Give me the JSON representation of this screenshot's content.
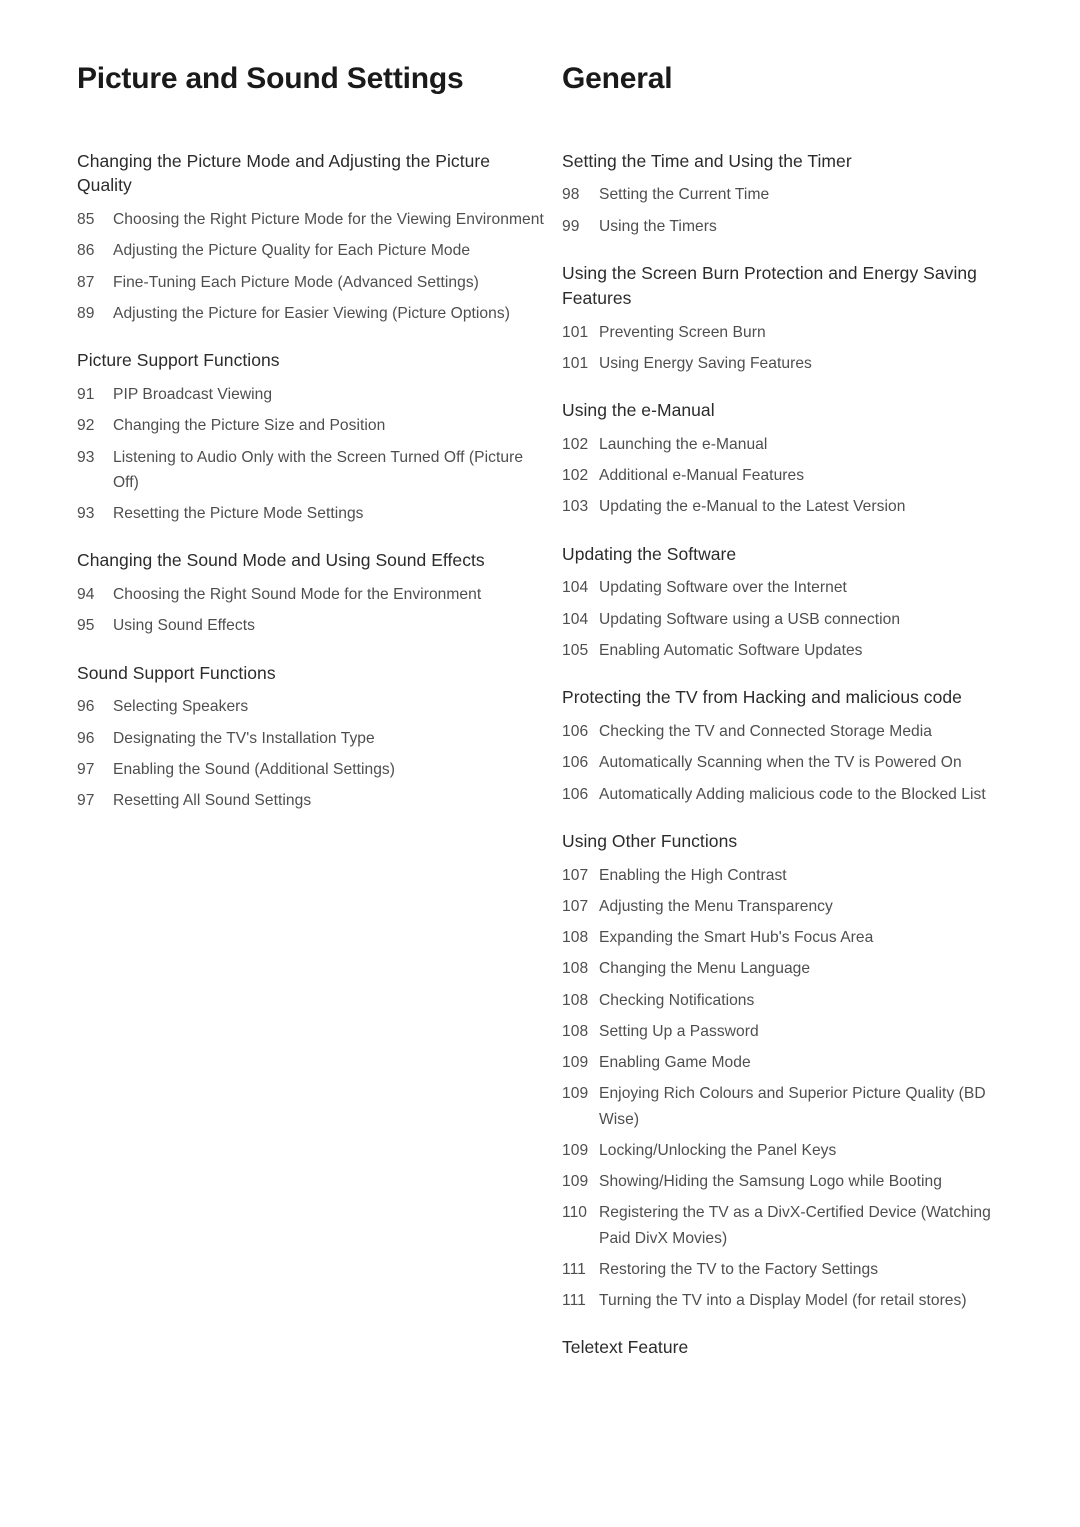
{
  "document": {
    "type": "table-of-contents",
    "columns": [
      {
        "title": "Picture and Sound Settings",
        "sections": [
          {
            "heading": "Changing the Picture Mode and Adjusting the Picture Quality",
            "entries": [
              {
                "page": "85",
                "title": "Choosing the Right Picture Mode for the Viewing Environment"
              },
              {
                "page": "86",
                "title": "Adjusting the Picture Quality for Each Picture Mode"
              },
              {
                "page": "87",
                "title": "Fine-Tuning Each Picture Mode (Advanced Settings)"
              },
              {
                "page": "89",
                "title": "Adjusting the Picture for Easier Viewing (Picture Options)"
              }
            ]
          },
          {
            "heading": "Picture Support Functions",
            "entries": [
              {
                "page": "91",
                "title": "PIP Broadcast Viewing"
              },
              {
                "page": "92",
                "title": "Changing the Picture Size and Position"
              },
              {
                "page": "93",
                "title": "Listening to Audio Only with the Screen Turned Off (Picture Off)"
              },
              {
                "page": "93",
                "title": "Resetting the Picture Mode Settings"
              }
            ]
          },
          {
            "heading": "Changing the Sound Mode and Using Sound Effects",
            "entries": [
              {
                "page": "94",
                "title": "Choosing the Right Sound Mode for the Environment"
              },
              {
                "page": "95",
                "title": "Using Sound Effects"
              }
            ]
          },
          {
            "heading": "Sound Support Functions",
            "entries": [
              {
                "page": "96",
                "title": "Selecting Speakers"
              },
              {
                "page": "96",
                "title": "Designating the TV's Installation Type"
              },
              {
                "page": "97",
                "title": "Enabling the Sound (Additional Settings)"
              },
              {
                "page": "97",
                "title": "Resetting All Sound Settings"
              }
            ]
          }
        ]
      },
      {
        "title": "General",
        "sections": [
          {
            "heading": "Setting the Time and Using the Timer",
            "entries": [
              {
                "page": "98",
                "title": "Setting the Current Time"
              },
              {
                "page": "99",
                "title": "Using the Timers"
              }
            ]
          },
          {
            "heading": "Using the Screen Burn Protection and Energy Saving Features",
            "entries": [
              {
                "page": "101",
                "title": "Preventing Screen Burn"
              },
              {
                "page": "101",
                "title": "Using Energy Saving Features"
              }
            ]
          },
          {
            "heading": "Using the e-Manual",
            "entries": [
              {
                "page": "102",
                "title": "Launching the e-Manual"
              },
              {
                "page": "102",
                "title": "Additional e-Manual Features"
              },
              {
                "page": "103",
                "title": "Updating the e-Manual to the Latest Version"
              }
            ]
          },
          {
            "heading": "Updating the Software",
            "entries": [
              {
                "page": "104",
                "title": "Updating Software over the Internet"
              },
              {
                "page": "104",
                "title": "Updating Software using a USB connection"
              },
              {
                "page": "105",
                "title": "Enabling Automatic Software Updates"
              }
            ]
          },
          {
            "heading": "Protecting the TV from Hacking and malicious code",
            "entries": [
              {
                "page": "106",
                "title": "Checking the TV and Connected Storage Media"
              },
              {
                "page": "106",
                "title": "Automatically Scanning when the TV is Powered On"
              },
              {
                "page": "106",
                "title": "Automatically Adding malicious code to the Blocked List"
              }
            ]
          },
          {
            "heading": "Using Other Functions",
            "entries": [
              {
                "page": "107",
                "title": "Enabling the High Contrast"
              },
              {
                "page": "107",
                "title": "Adjusting the Menu Transparency"
              },
              {
                "page": "108",
                "title": "Expanding the Smart Hub's Focus Area"
              },
              {
                "page": "108",
                "title": "Changing the Menu Language"
              },
              {
                "page": "108",
                "title": "Checking Notifications"
              },
              {
                "page": "108",
                "title": "Setting Up a Password"
              },
              {
                "page": "109",
                "title": "Enabling Game Mode"
              },
              {
                "page": "109",
                "title": "Enjoying Rich Colours and Superior Picture Quality (BD Wise)"
              },
              {
                "page": "109",
                "title": "Locking/Unlocking the Panel Keys"
              },
              {
                "page": "109",
                "title": "Showing/Hiding the Samsung Logo while Booting"
              },
              {
                "page": "110",
                "title": "Registering the TV as a DivX-Certified Device (Watching Paid DivX Movies)"
              },
              {
                "page": "111",
                "title": "Restoring the TV to the Factory Settings"
              },
              {
                "page": "111",
                "title": "Turning the TV into a Display Model (for retail stores)"
              }
            ]
          },
          {
            "heading": "Teletext Feature",
            "entries": []
          }
        ]
      }
    ]
  },
  "colors": {
    "page_background": "#ffffff",
    "chapter_title": "#1a1a1a",
    "section_heading": "#2b2b2b",
    "entry_text": "#4e4e4e"
  }
}
